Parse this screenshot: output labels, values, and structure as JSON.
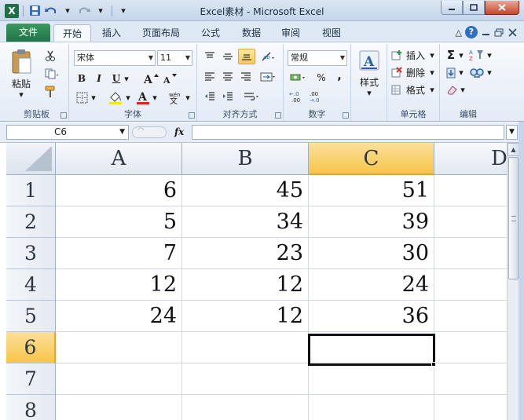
{
  "window": {
    "title": "Excel素材 - Microsoft Excel",
    "logo": "X"
  },
  "tabs": {
    "file": "文件",
    "items": [
      "开始",
      "插入",
      "页面布局",
      "公式",
      "数据",
      "审阅",
      "视图"
    ],
    "active": "开始"
  },
  "ribbon": {
    "clipboard": {
      "paste": "粘贴",
      "label": "剪贴板"
    },
    "font": {
      "name": "宋体",
      "size": "11",
      "label": "字体",
      "bold": "B",
      "italic": "I",
      "underline": "U"
    },
    "alignment": {
      "label": "对齐方式"
    },
    "number": {
      "format": "常规",
      "label": "数字",
      "percent": "%",
      "comma": ","
    },
    "styles": {
      "button": "样式"
    },
    "cells": {
      "insert": "插入",
      "delete": "删除",
      "format": "格式",
      "label": "单元格"
    },
    "editing": {
      "label": "编辑"
    }
  },
  "formula_bar": {
    "name_box": "C6",
    "fx": "fx",
    "value": ""
  },
  "sheet": {
    "columns": [
      "A",
      "B",
      "C",
      "D"
    ],
    "rows": [
      "1",
      "2",
      "3",
      "4",
      "5",
      "6",
      "7",
      "8"
    ],
    "selected_col": "C",
    "selected_row": "6",
    "cells": [
      [
        "6",
        "45",
        "51"
      ],
      [
        "5",
        "34",
        "39"
      ],
      [
        "7",
        "23",
        "30"
      ],
      [
        "12",
        "12",
        "24"
      ],
      [
        "24",
        "12",
        "36"
      ]
    ]
  }
}
